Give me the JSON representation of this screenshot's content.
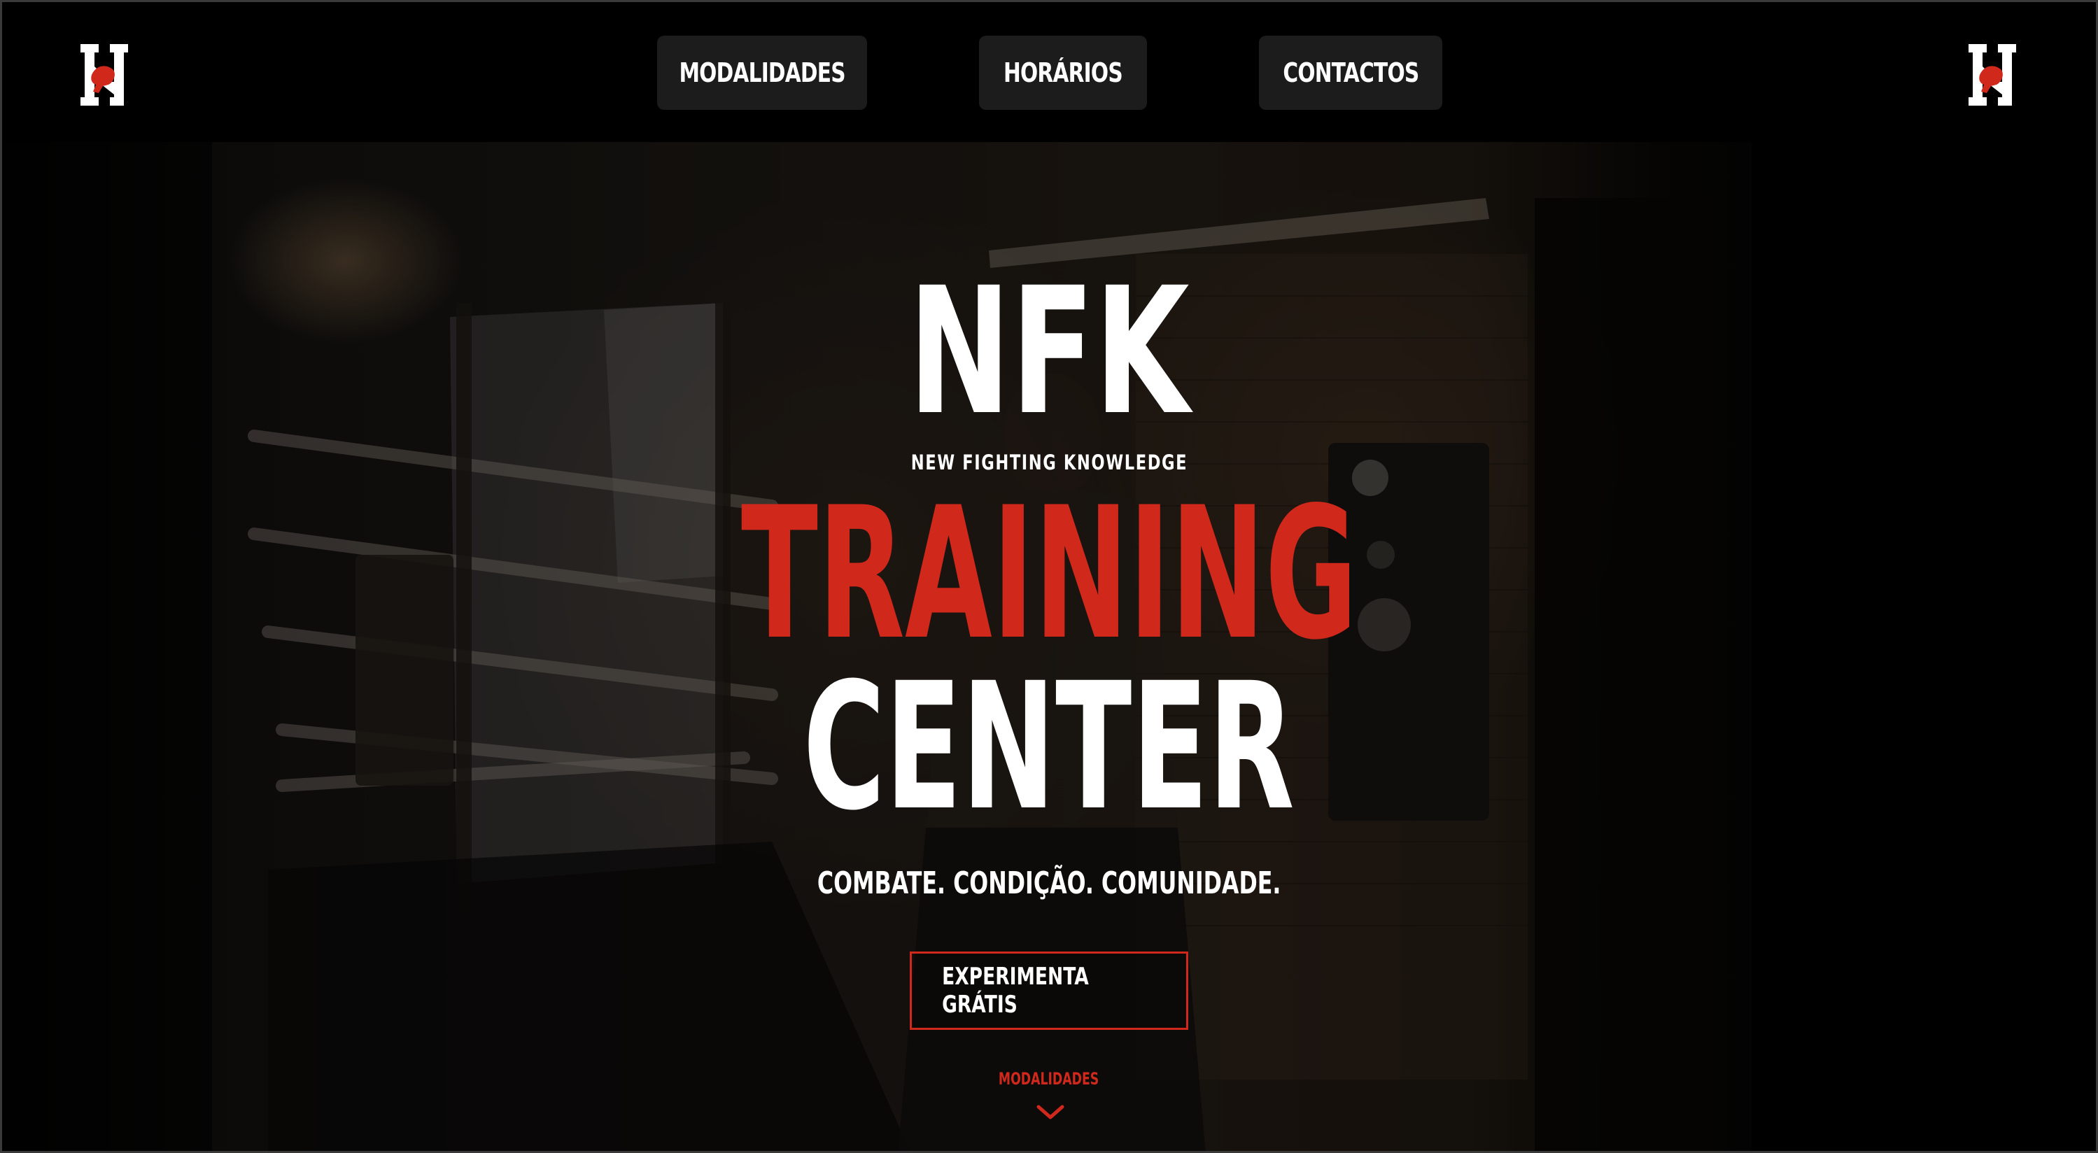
{
  "header": {
    "nav": [
      {
        "label": "MODALIDADES"
      },
      {
        "label": "HORÁRIOS"
      },
      {
        "label": "CONTACTOS"
      }
    ],
    "logo_icon": "nfk-logo-icon"
  },
  "hero": {
    "title_line1": "NFK",
    "subtitle": "NEW FIGHTING KNOWLEDGE",
    "title_line2": "TRAINING",
    "title_line3": "CENTER",
    "tagline": "COMBATE. CONDIÇÃO. COMUNIDADE.",
    "cta_label": "EXPERIMENTA GRÁTIS",
    "scroll_label": "MODALIDADES",
    "scroll_icon": "chevron-down-icon"
  },
  "colors": {
    "accent": "#d1281c",
    "background": "#000000",
    "nav_button": "#1c1c1c",
    "text": "#ffffff"
  }
}
